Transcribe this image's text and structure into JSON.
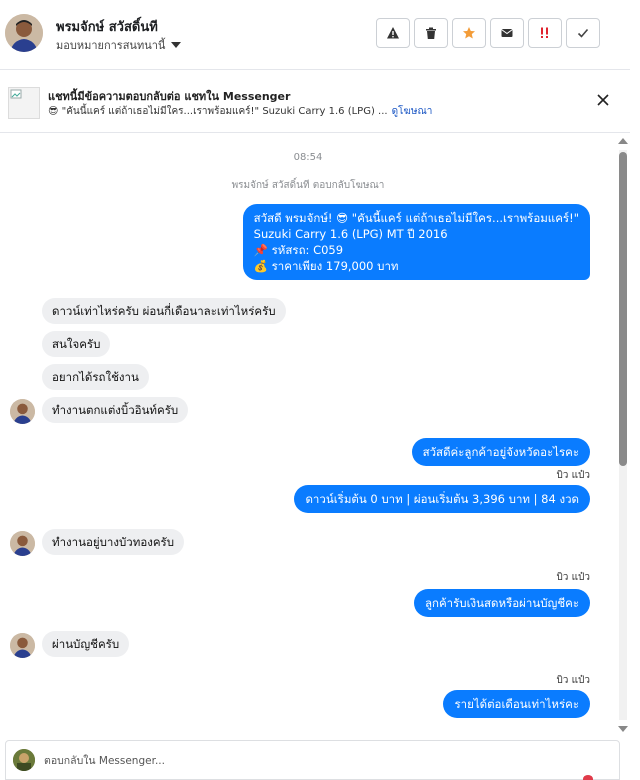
{
  "header": {
    "contact_name": "พรมจักษ์ สวัสดิ์นที",
    "assign_label": "มอบหมายการสนทนานี้",
    "actions": [
      {
        "id": "spam",
        "icon": "warning-icon"
      },
      {
        "id": "delete",
        "icon": "trash-icon"
      },
      {
        "id": "star",
        "icon": "star-icon"
      },
      {
        "id": "unread",
        "icon": "envelope-icon"
      },
      {
        "id": "follow-up",
        "icon": "exclamation-icon"
      },
      {
        "id": "done",
        "icon": "check-icon"
      }
    ],
    "colors": {
      "star": "#f39c38",
      "follow_up": "#e0232e"
    }
  },
  "banner": {
    "title": "แชทนี้มีข้อความตอบกลับต่อ แชทใน Messenger",
    "subtitle": "😎 \"คันนี้แคร์ แต่ถ้าเธอไม่มีใคร...เราพร้อมแคร์!\" Suzuki Carry 1.6 (LPG) ...",
    "link": "ดูโฆษณา"
  },
  "chat": {
    "timestamp": "08:54",
    "notice": "พรมจักษ์ สวัสดิ์นที ตอบกลับโฆษณา",
    "ad_message": {
      "line1": "สวัสดี พรมจักษ์! 😎 \"คันนี้แคร์ แต่ถ้าเธอไม่มีใคร...เราพร้อมแคร์!\"",
      "line2": "Suzuki Carry 1.6 (LPG) MT ปี 2016",
      "line3": "📌 รหัสรถ: C059",
      "line4": "💰 ราคาเพียง 179,000 บาท"
    },
    "incoming_1": [
      "ดาวน์เท่าไหร่ครับ ผ่อนกี่เดือนาละเท่าไหร่ครับ",
      "สนใจครับ",
      "อยากได้รถใช้งาน",
      "ทำงานตกแต่งบิ้วอินท์ครับ"
    ],
    "outgoing_1": "สวัสดีค่ะลูกค้าอยู่จังหวัดอะไรคะ",
    "seen_1": "บิว แป๋ว",
    "outgoing_2": "ดาวน์เริ่มต้น 0 บาท | ผ่อนเริ่มต้น 3,396 บาท | 84 งวด",
    "incoming_2": "ทำงานอยู่บางบัวทองครับ",
    "seen_2": "บิว แป๋ว",
    "outgoing_3": "ลูกค้ารับเงินสดหรือผ่านบัญชีคะ",
    "incoming_3": "ผ่านบัญชีครับ",
    "seen_3": "บิว แป๋ว",
    "outgoing_4": "รายได้ต่อเดือนเท่าไหร่คะ"
  },
  "composer": {
    "placeholder": "ตอบกลับใน Messenger..."
  },
  "colors": {
    "accent": "#0a7cff",
    "incoming_bubble": "#eeeff1"
  }
}
